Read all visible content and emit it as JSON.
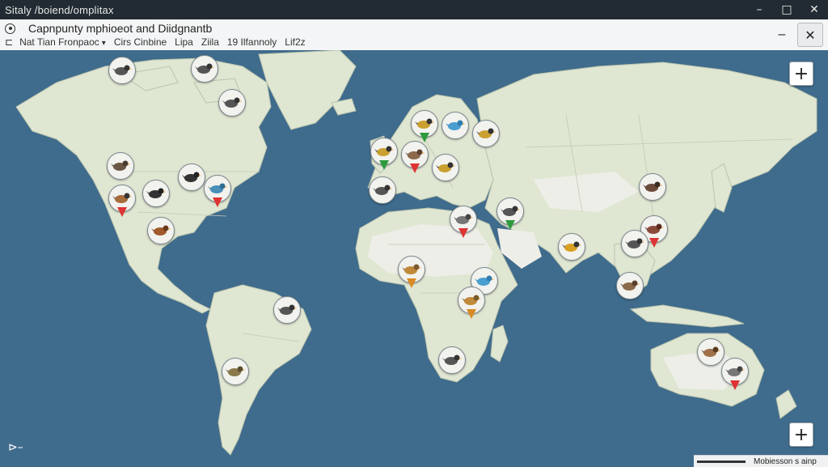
{
  "window": {
    "title": "Sitaly /boiend/omplitax",
    "minimize_glyph": "–",
    "maximize_glyph": "□",
    "close_glyph": "✕"
  },
  "panel": {
    "title": "Capnpunty mphioeot and Diidgnantb",
    "back_glyph": "⊏",
    "filters": [
      {
        "label": "Nat Tian Fronpaoc",
        "dropdown": true
      },
      {
        "label": "Cirs Cinbine",
        "dropdown": false
      },
      {
        "label": "Lipa",
        "dropdown": false
      },
      {
        "label": "Ziila",
        "dropdown": false
      },
      {
        "label": "19 Ilfannoly",
        "dropdown": false
      },
      {
        "label": "Lif2z",
        "dropdown": false
      }
    ],
    "dropdown_caret": "▾",
    "minimize_glyph": "–",
    "close_glyph": "✕"
  },
  "map": {
    "ocean_color": "#3f6b8c",
    "land_color": "#dfe6d2",
    "desert_color": "#eeeee8",
    "zoom_in_top": "+",
    "zoom_in_bottom": "+",
    "home_glyph": "⊳–",
    "scale_text": "Mobiesson s ainp",
    "markers": [
      {
        "name": "bird-marker-arctic-canada",
        "icon": "bird-icon",
        "pin": "none"
      },
      {
        "name": "bird-marker-baffin",
        "icon": "bird-icon",
        "pin": "none"
      },
      {
        "name": "bird-marker-hudson",
        "icon": "bird-icon",
        "pin": "none"
      },
      {
        "name": "bird-marker-west-canada",
        "icon": "bird-icon",
        "pin": "none"
      },
      {
        "name": "bird-marker-west-usa",
        "icon": "bird-icon",
        "pin": "red"
      },
      {
        "name": "bird-marker-central-usa",
        "icon": "bird-icon",
        "pin": "none"
      },
      {
        "name": "bird-marker-great-lakes",
        "icon": "bird-icon",
        "pin": "none"
      },
      {
        "name": "bird-marker-east-usa",
        "icon": "bird-icon",
        "pin": "red"
      },
      {
        "name": "bird-marker-mexico",
        "icon": "bird-icon",
        "pin": "none"
      },
      {
        "name": "bird-marker-amazon",
        "icon": "bird-icon",
        "pin": "none"
      },
      {
        "name": "bird-marker-argentina",
        "icon": "bird-icon",
        "pin": "none"
      },
      {
        "name": "bird-marker-scandinavia",
        "icon": "bird-icon",
        "pin": "green"
      },
      {
        "name": "bird-marker-baltic",
        "icon": "bird-icon",
        "pin": "none"
      },
      {
        "name": "bird-marker-russia-west",
        "icon": "bird-icon",
        "pin": "none"
      },
      {
        "name": "bird-marker-uk",
        "icon": "bird-icon",
        "pin": "green"
      },
      {
        "name": "bird-marker-germany",
        "icon": "bird-icon",
        "pin": "red"
      },
      {
        "name": "bird-marker-balkans",
        "icon": "bird-icon",
        "pin": "none"
      },
      {
        "name": "bird-marker-iberia",
        "icon": "bird-icon",
        "pin": "none"
      },
      {
        "name": "bird-marker-egypt",
        "icon": "bird-icon",
        "pin": "red"
      },
      {
        "name": "bird-marker-middle-east",
        "icon": "bird-icon",
        "pin": "green"
      },
      {
        "name": "bird-marker-west-africa",
        "icon": "bird-icon",
        "pin": "orange"
      },
      {
        "name": "bird-marker-horn-africa",
        "icon": "bird-icon",
        "pin": "none"
      },
      {
        "name": "bird-marker-east-africa",
        "icon": "bird-icon",
        "pin": "orange"
      },
      {
        "name": "bird-marker-south-africa",
        "icon": "bird-icon",
        "pin": "none"
      },
      {
        "name": "bird-marker-india",
        "icon": "bird-icon",
        "pin": "none"
      },
      {
        "name": "bird-marker-china",
        "icon": "bird-icon",
        "pin": "none"
      },
      {
        "name": "bird-marker-china-east",
        "icon": "bird-icon",
        "pin": "red"
      },
      {
        "name": "bird-marker-indochina",
        "icon": "bird-icon",
        "pin": "none"
      },
      {
        "name": "bird-marker-philippines",
        "icon": "bird-icon",
        "pin": "none"
      },
      {
        "name": "bird-marker-australia-west",
        "icon": "bird-icon",
        "pin": "none"
      },
      {
        "name": "bird-marker-australia-east",
        "icon": "bird-icon",
        "pin": "red"
      }
    ]
  }
}
